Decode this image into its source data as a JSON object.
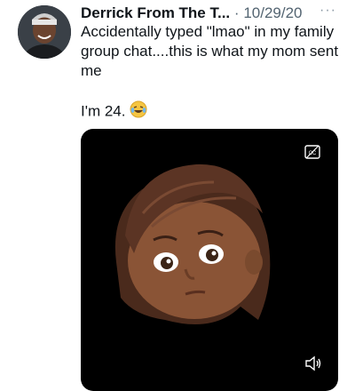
{
  "tweet": {
    "author_name": "Derrick From The T...",
    "separator": "·",
    "date": "10/29/20",
    "more_label": "···",
    "text": "Accidentally typed \"lmao\" in my family group chat....this is what my mom sent me",
    "text_2": "I'm 24.",
    "emoji": "laughing-tears-emoji"
  },
  "media": {
    "type": "video",
    "content": "memoji-face",
    "controls": [
      "closed-captions-icon",
      "volume-icon"
    ]
  },
  "colors": {
    "text": "#0f1419",
    "secondary": "#536471",
    "media_bg": "#000000"
  }
}
